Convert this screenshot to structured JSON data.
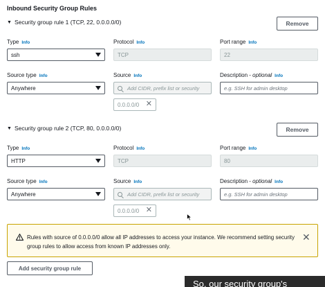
{
  "section_title": "Inbound Security Group Rules",
  "labels": {
    "type": "Type",
    "protocol": "Protocol",
    "port_range": "Port range",
    "source_type": "Source type",
    "source": "Source",
    "description": "Description -",
    "optional": "optional",
    "info": "Info"
  },
  "rules": [
    {
      "header": "Security group rule 1 (TCP, 22, 0.0.0.0/0)",
      "remove_label": "Remove",
      "type": "ssh",
      "protocol": "TCP",
      "port_range": "22",
      "source_type": "Anywhere",
      "source_placeholder": "Add CIDR, prefix list or security",
      "description_placeholder": "e.g. SSH for admin desktop",
      "token": "0.0.0.0/0"
    },
    {
      "header": "Security group rule 2 (TCP, 80, 0.0.0.0/0)",
      "remove_label": "Remove",
      "type": "HTTP",
      "protocol": "TCP",
      "port_range": "80",
      "source_type": "Anywhere",
      "source_placeholder": "Add CIDR, prefix list or security",
      "description_placeholder": "e.g. SSH for admin desktop",
      "token": "0.0.0.0/0"
    }
  ],
  "warning": {
    "text": "Rules with source of 0.0.0.0/0 allow all IP addresses to access your instance. We recommend setting security group rules to allow access from known IP addresses only.",
    "icon": "warning-icon",
    "color": "#c8a300"
  },
  "add_rule_label": "Add security group rule",
  "caption": "So, our security group's",
  "colors": {
    "info_link": "#0073bb",
    "warning_bg": "#fffbeb",
    "disabled_bg": "#eaeded"
  }
}
